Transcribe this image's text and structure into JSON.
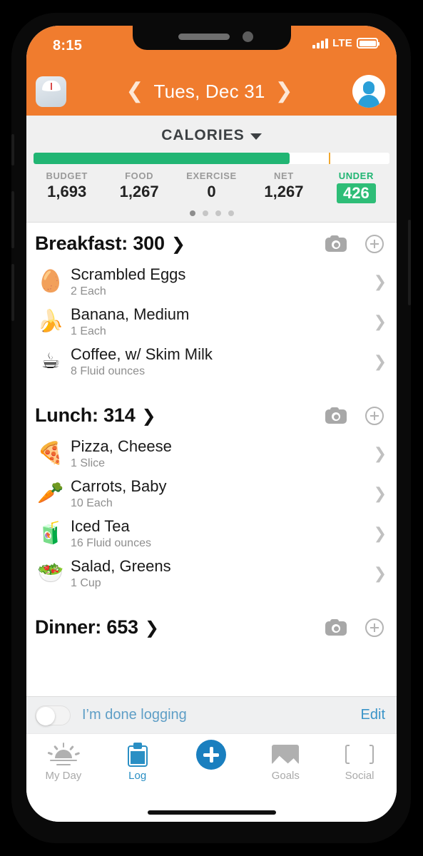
{
  "status_bar": {
    "time": "8:15",
    "network": "LTE",
    "signal_icon": "signal-bars-icon",
    "battery_icon": "battery-full-icon"
  },
  "nav": {
    "scale_icon": "bathroom-scale-icon",
    "prev_icon": "chevron-left-icon",
    "next_icon": "chevron-right-icon",
    "date": "Tues, Dec 31",
    "avatar_icon": "profile-avatar-icon"
  },
  "summary": {
    "title": "CALORIES",
    "caret_icon": "chevron-down-icon",
    "progress_percent": 72,
    "tick_percent": 83,
    "accent_green": "#21b573",
    "accent_orange": "#f07c2e",
    "tick_color": "#f0a830",
    "stats": [
      {
        "label": "BUDGET",
        "value": "1,693"
      },
      {
        "label": "FOOD",
        "value": "1,267"
      },
      {
        "label": "EXERCISE",
        "value": "0"
      },
      {
        "label": "NET",
        "value": "1,267"
      },
      {
        "label": "UNDER",
        "value": "426"
      }
    ],
    "page_dots": 4,
    "active_dot": 0
  },
  "meals": [
    {
      "name": "Breakfast",
      "title": "Breakfast: 300",
      "calories": 300,
      "chevron_icon": "chevron-right-icon",
      "camera_icon": "camera-icon",
      "add_icon": "plus-circle-icon",
      "items": [
        {
          "emoji": "🥚",
          "icon_name": "egg-icon",
          "name": "Scrambled Eggs",
          "serving": "2 Each"
        },
        {
          "emoji": "🍌",
          "icon_name": "banana-icon",
          "name": "Banana, Medium",
          "serving": "1 Each"
        },
        {
          "emoji": "☕",
          "icon_name": "coffee-icon",
          "name": "Coffee, w/ Skim Milk",
          "serving": "8 Fluid ounces"
        }
      ]
    },
    {
      "name": "Lunch",
      "title": "Lunch: 314",
      "calories": 314,
      "chevron_icon": "chevron-right-icon",
      "camera_icon": "camera-icon",
      "add_icon": "plus-circle-icon",
      "items": [
        {
          "emoji": "🍕",
          "icon_name": "pizza-icon",
          "name": "Pizza, Cheese",
          "serving": "1 Slice"
        },
        {
          "emoji": "🥕",
          "icon_name": "carrot-icon",
          "name": "Carrots, Baby",
          "serving": "10 Each"
        },
        {
          "emoji": "🧃",
          "icon_name": "iced-tea-icon",
          "name": "Iced Tea",
          "serving": "16 Fluid ounces"
        },
        {
          "emoji": "🥗",
          "icon_name": "salad-icon",
          "name": "Salad, Greens",
          "serving": "1 Cup"
        }
      ]
    },
    {
      "name": "Dinner",
      "title": "Dinner: 653",
      "calories": 653,
      "chevron_icon": "chevron-right-icon",
      "camera_icon": "camera-icon",
      "add_icon": "plus-circle-icon",
      "items": []
    }
  ],
  "done_bar": {
    "toggle_state": "off",
    "label": "I’m done logging",
    "edit_label": "Edit",
    "link_color": "#3a94c8"
  },
  "tab_bar": {
    "items": [
      {
        "label": "My Day",
        "icon": "sunrise-icon",
        "active": false
      },
      {
        "label": "Log",
        "icon": "clipboard-icon",
        "active": true
      },
      {
        "label": "",
        "icon": "add-circle-icon",
        "active": false
      },
      {
        "label": "Goals",
        "icon": "mountain-photo-icon",
        "active": false
      },
      {
        "label": "Social",
        "icon": "people-icon",
        "active": false
      }
    ]
  }
}
